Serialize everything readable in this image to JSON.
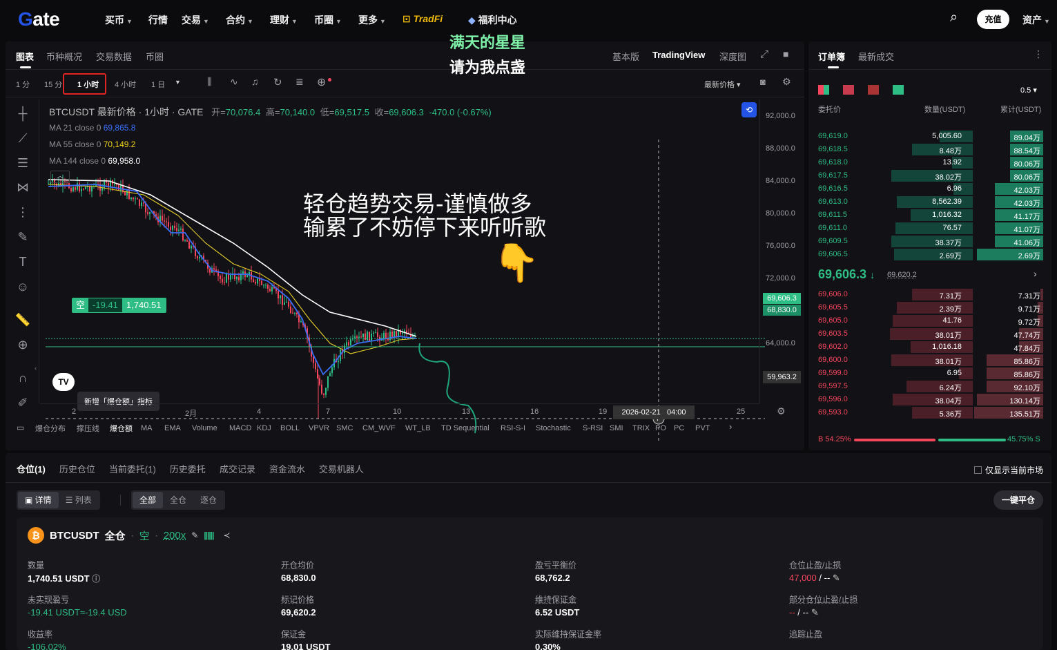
{
  "nav": {
    "logo": "Gate",
    "items": [
      "买币",
      "行情",
      "交易",
      "合约",
      "理财",
      "币圈",
      "更多"
    ],
    "tradfi": "TradFi",
    "welfare": "福利中心",
    "recharge": "充值",
    "assets": "资产"
  },
  "overlay": {
    "top_line1": "满天的星星",
    "top_line2": "请为我点盏",
    "mid_line1": "轻仓趋势交易-谨慎做多",
    "mid_line2": "输累了不妨停下来听听歌"
  },
  "chart": {
    "tabs": [
      "图表",
      "币种概况",
      "交易数据",
      "币圈"
    ],
    "views": [
      "基本版",
      "TradingView",
      "深度图"
    ],
    "intervals": [
      "1 分",
      "15 分",
      "1 小时",
      "4 小时",
      "1 日"
    ],
    "price_type": "最新价格",
    "header": "BTCUSDT 最新价格 · 1小时 · GATE",
    "ohlc": {
      "o_label": "开=",
      "o": "70,076.4",
      "h_label": "高=",
      "h": "70,140.0",
      "l_label": "低=",
      "l": "69,517.5",
      "c_label": "收=",
      "c": "69,606.3",
      "chg": "-470.0 (-0.67%)"
    },
    "ma": [
      {
        "label": "MA 21 close 0",
        "value": "69,865.8",
        "color": "#3b6cf5"
      },
      {
        "label": "MA 55 close 0",
        "value": "70,149.2",
        "color": "#f0d21b"
      },
      {
        "label": "MA 144 close 0",
        "value": "69,958.0",
        "color": "#ffffff"
      }
    ],
    "y_ticks": [
      "92,000.0",
      "88,000.0",
      "84,000.0",
      "80,000.0",
      "76,000.0",
      "72,000.0",
      "64,000.0"
    ],
    "price_tag_last": "69,606.3",
    "price_tag_entry": "68,830.0",
    "price_tag_cross": "59,963.2",
    "position_tag": {
      "side": "空",
      "pnl": "-19.41",
      "size": "1,740.51"
    },
    "x_ticks": [
      "2",
      "2月",
      "4",
      "7",
      "10",
      "13",
      "16",
      "19",
      "25"
    ],
    "x_cursor": "2026-02-21",
    "x_cursor_time": "04:00",
    "tooltip": "新增「爆仓额」指标",
    "indicators": [
      "爆仓分布",
      "撑压线",
      "爆仓额",
      "MA",
      "EMA",
      "Volume",
      "MACD",
      "KDJ",
      "BOLL",
      "VPVR",
      "SMC",
      "CM_WVF",
      "WT_LB",
      "TD Sequential",
      "RSI-S-I",
      "Stochastic",
      "S-RSI",
      "SMI",
      "TRIX",
      "PO",
      "PC",
      "PVT"
    ]
  },
  "orderbook": {
    "tabs": [
      "订单簿",
      "最新成交"
    ],
    "precision": "0.5",
    "headers": [
      "委托价",
      "数量(USDT)",
      "累计(USDT)"
    ],
    "asks": [
      {
        "price": "69,619.0",
        "qty": "5,005.60",
        "cum": "89.04万"
      },
      {
        "price": "69,618.5",
        "qty": "8.48万",
        "cum": "88.54万"
      },
      {
        "price": "69,618.0",
        "qty": "13.92",
        "cum": "80.06万"
      },
      {
        "price": "69,617.5",
        "qty": "38.02万",
        "cum": "80.06万"
      },
      {
        "price": "69,616.5",
        "qty": "6.96",
        "cum": "42.03万"
      },
      {
        "price": "69,613.0",
        "qty": "8,562.39",
        "cum": "42.03万"
      },
      {
        "price": "69,611.5",
        "qty": "1,016.32",
        "cum": "41.17万"
      },
      {
        "price": "69,611.0",
        "qty": "76.57",
        "cum": "41.07万"
      },
      {
        "price": "69,609.5",
        "qty": "38.37万",
        "cum": "41.06万"
      },
      {
        "price": "69,606.5",
        "qty": "2.69万",
        "cum": "2.69万"
      }
    ],
    "mid_price": "69,606.3",
    "mark_price": "69,620.2",
    "bids": [
      {
        "price": "69,606.0",
        "qty": "7.31万",
        "cum": "7.31万"
      },
      {
        "price": "69,605.5",
        "qty": "2.39万",
        "cum": "9.71万"
      },
      {
        "price": "69,605.0",
        "qty": "41.76",
        "cum": "9.72万"
      },
      {
        "price": "69,603.5",
        "qty": "38.01万",
        "cum": "47.74万"
      },
      {
        "price": "69,602.0",
        "qty": "1,016.18",
        "cum": "47.84万"
      },
      {
        "price": "69,600.0",
        "qty": "38.01万",
        "cum": "85.86万"
      },
      {
        "price": "69,599.0",
        "qty": "6.95",
        "cum": "85.86万"
      },
      {
        "price": "69,597.5",
        "qty": "6.24万",
        "cum": "92.10万"
      },
      {
        "price": "69,596.0",
        "qty": "38.04万",
        "cum": "130.14万"
      },
      {
        "price": "69,593.0",
        "qty": "5.36万",
        "cum": "135.51万"
      }
    ],
    "buy_ratio": "B 54.25%",
    "sell_ratio": "45.75% S"
  },
  "positions": {
    "tabs": [
      "仓位(1)",
      "历史仓位",
      "当前委托(1)",
      "历史委托",
      "成交记录",
      "资金流水",
      "交易机器人"
    ],
    "only_current": "仅显示当前市场",
    "view_detail": "详情",
    "view_list": "列表",
    "filters": [
      "全部",
      "全仓",
      "逐仓"
    ],
    "close_all": "一键平仓",
    "symbol": "BTCUSDT",
    "margin_mode": "全仓",
    "side": "空",
    "leverage": "200x",
    "fields": [
      {
        "label": "数量",
        "value": "1,740.51 USDT"
      },
      {
        "label": "开仓均价",
        "value": "68,830.0"
      },
      {
        "label": "盈亏平衡价",
        "value": "68,762.2"
      },
      {
        "label": "仓位止盈/止损",
        "value_tp": "47,000",
        "value_sl": "--"
      },
      {
        "label": "未实现盈亏",
        "value": "-19.41 USDT≈-19.4 USD"
      },
      {
        "label": "标记价格",
        "value": "69,620.2"
      },
      {
        "label": "维持保证金",
        "value": "6.52 USDT"
      },
      {
        "label": "部分仓位止盈/止损",
        "value_tp": "--",
        "value_sl": "--"
      },
      {
        "label": "收益率",
        "value": "-106.02%"
      },
      {
        "label": "保证金",
        "value": "19.01 USDT"
      },
      {
        "label": "实际维持保证金率",
        "value": "0.30%"
      },
      {
        "label": "追踪止盈",
        "value": ""
      }
    ]
  }
}
